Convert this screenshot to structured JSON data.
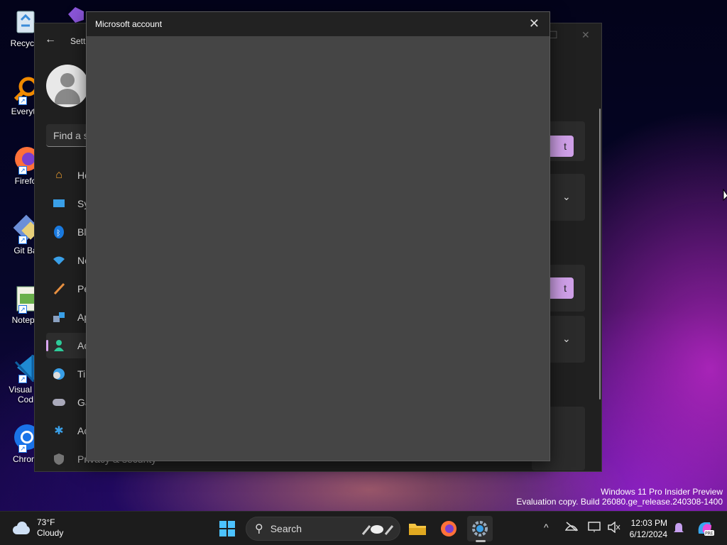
{
  "desktop_icons": [
    {
      "label": "Recycle",
      "icon": "recycle-bin-icon"
    },
    {
      "label": "Everyth",
      "icon": "everything-icon"
    },
    {
      "label": "Firefo",
      "icon": "firefox-icon"
    },
    {
      "label": "Git Ba",
      "icon": "git-bash-icon"
    },
    {
      "label": "Notepa",
      "icon": "notepad-icon"
    },
    {
      "label": "Visual St\nCod",
      "icon": "vscode-icon"
    },
    {
      "label": "Chrom",
      "icon": "chrome-icon"
    }
  ],
  "settings": {
    "title": "Setti",
    "search_placeholder": "Find a s",
    "nav": [
      {
        "label": "Ho",
        "icon": "home-icon"
      },
      {
        "label": "Sy",
        "icon": "system-icon"
      },
      {
        "label": "Bl",
        "icon": "bluetooth-icon"
      },
      {
        "label": "Ne",
        "icon": "network-icon"
      },
      {
        "label": "Pe",
        "icon": "personalization-icon"
      },
      {
        "label": "Ap",
        "icon": "apps-icon"
      },
      {
        "label": "Ac",
        "icon": "accounts-icon"
      },
      {
        "label": "Ti",
        "icon": "time-language-icon"
      },
      {
        "label": "Ga",
        "icon": "gaming-icon"
      },
      {
        "label": "Ac",
        "icon": "accessibility-icon"
      },
      {
        "label": "Privacy & security",
        "icon": "shield-icon"
      }
    ],
    "button1": "t",
    "button2": "t"
  },
  "dialog": {
    "title": "Microsoft account",
    "close": "✕"
  },
  "watermark": {
    "line1": "Windows 11 Pro Insider Preview",
    "line2": "Evaluation copy. Build 26080.ge_release.240308-1400"
  },
  "taskbar": {
    "weather_temp": "73°F",
    "weather_desc": "Cloudy",
    "search_label": "Search",
    "time": "12:03 PM",
    "date": "6/12/2024"
  }
}
